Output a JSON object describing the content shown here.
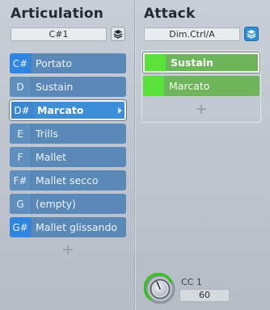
{
  "articulation": {
    "title": "Articulation",
    "key_field": "C#1",
    "rows": [
      {
        "key": "C#",
        "label": "Portato"
      },
      {
        "key": "D",
        "label": "Sustain"
      },
      {
        "key": "D#",
        "label": "Marcato"
      },
      {
        "key": "E",
        "label": "Trills"
      },
      {
        "key": "F",
        "label": "Mallet"
      },
      {
        "key": "F#",
        "label": "Mallet secco"
      },
      {
        "key": "G",
        "label": "(empty)"
      },
      {
        "key": "G#",
        "label": "Mallet glissando"
      }
    ],
    "selected_index": 2,
    "add_label": "+"
  },
  "attack": {
    "title": "Attack",
    "field": "Dim.Ctrl/A",
    "rows": [
      {
        "label": "Sustain"
      },
      {
        "label": "Marcato"
      }
    ],
    "selected_index": 0,
    "add_label": "+"
  },
  "cc": {
    "label": "CC 1",
    "value": "60"
  },
  "icons": {
    "stack_left": "layers-icon",
    "stack_right": "layers-icon",
    "knob": "knob-icon"
  },
  "colors": {
    "articulation_row": "#5a89b7",
    "articulation_selected": "#3f8fd8",
    "attack_row": "#6db45a",
    "attack_swatch": "#58e23a",
    "accent_blue": "#2f8fd6"
  }
}
